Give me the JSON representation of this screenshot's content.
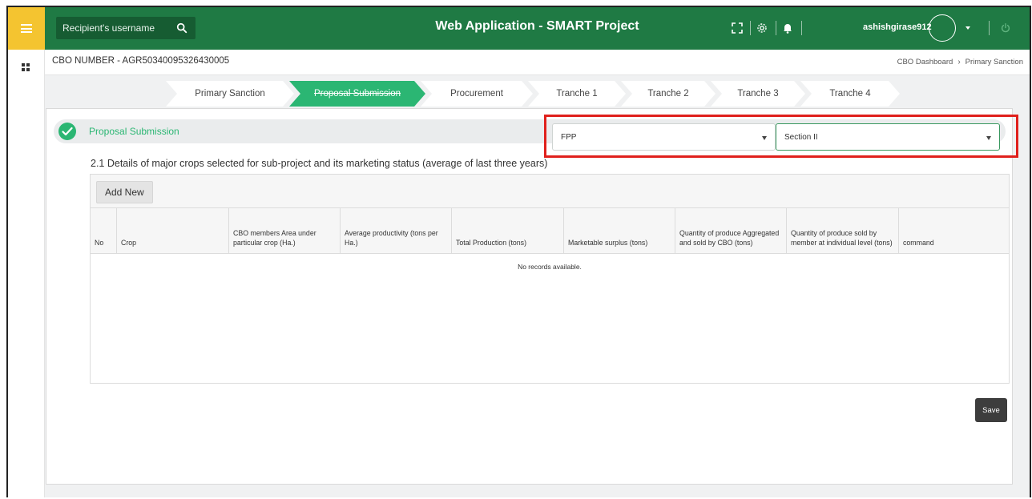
{
  "header": {
    "search_placeholder": "Recipient's username",
    "title": "Web Application - SMART Project",
    "username": "ashishgirase912",
    "icons": [
      "fullscreen-icon",
      "settings-icon",
      "bell-icon",
      "power-icon",
      "search-icon",
      "menu-icon"
    ]
  },
  "subbar": {
    "cbo_number": "CBO NUMBER - AGR50340095326430005",
    "breadcrumb": [
      "CBO Dashboard",
      "Primary Sanction"
    ]
  },
  "stepper": {
    "steps": [
      "Primary Sanction",
      "Proposal Submission",
      "Procurement",
      "Tranche 1",
      "Tranche 2",
      "Tranche 3",
      "Tranche 4"
    ],
    "active_index": 1
  },
  "section": {
    "title": "Proposal Submission",
    "type_select": "FPP",
    "section_select": "Section II"
  },
  "table": {
    "heading": "2.1 Details of major crops selected for sub-project and its marketing status (average of last three years)",
    "add_label": "Add New",
    "columns": [
      "No",
      "Crop",
      "CBO members Area under particular crop (Ha.)",
      "Average productivity (tons per Ha.)",
      "Total Production (tons)",
      "Marketable surplus (tons)",
      "Quantity of produce Aggregated and sold by CBO (tons)",
      "Quantity of produce sold by member at individual level (tons)",
      "command"
    ],
    "empty_text": "No records available."
  },
  "actions": {
    "save_label": "Save"
  },
  "colors": {
    "header_green": "#1f7a44",
    "accent_green": "#2bb673",
    "menu_yellow": "#f4c430",
    "highlight_red": "#e0201c",
    "save_dark": "#3d3d3d"
  }
}
